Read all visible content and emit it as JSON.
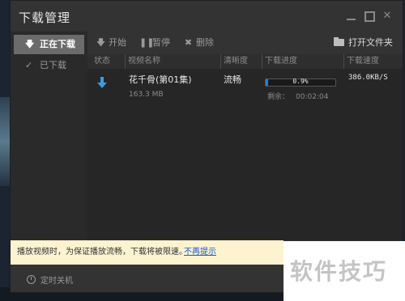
{
  "window": {
    "title": "下载管理",
    "controls": {
      "minimize": "minimize",
      "maximize": "maximize",
      "close": "✕"
    }
  },
  "sidebar": {
    "items": [
      {
        "label": "正在下载",
        "icon": "download-arrow-icon",
        "active": true
      },
      {
        "label": "已下载",
        "icon": "check-icon",
        "active": false
      }
    ]
  },
  "toolbar": {
    "start": "开始",
    "pause": "暂停",
    "delete": "删除",
    "open_folder": "打开文件夹"
  },
  "table": {
    "columns": [
      "状态",
      "视频名称",
      "清晰度",
      "下载进度",
      "下载速度"
    ],
    "rows": [
      {
        "status_icon": "download-arrow-icon",
        "name": "花千骨(第01集)",
        "size": "163.3 MB",
        "quality": "流畅",
        "progress_text": "0.9%",
        "progress_value": 0.009,
        "remain_label": "剩余：",
        "remain_value": "00:02:04",
        "speed": "386.0KB/S"
      }
    ]
  },
  "notice": {
    "text": "播放视频时，为保证播放流畅，下载将被限速。",
    "link": "不再提示"
  },
  "bottom": {
    "shutdown": "定时关机"
  },
  "watermark": {
    "text": "软件技巧"
  },
  "colors": {
    "accent": "#2b7fd6",
    "notice_bg": "#fdf3d0",
    "link": "#1a5cc8"
  }
}
